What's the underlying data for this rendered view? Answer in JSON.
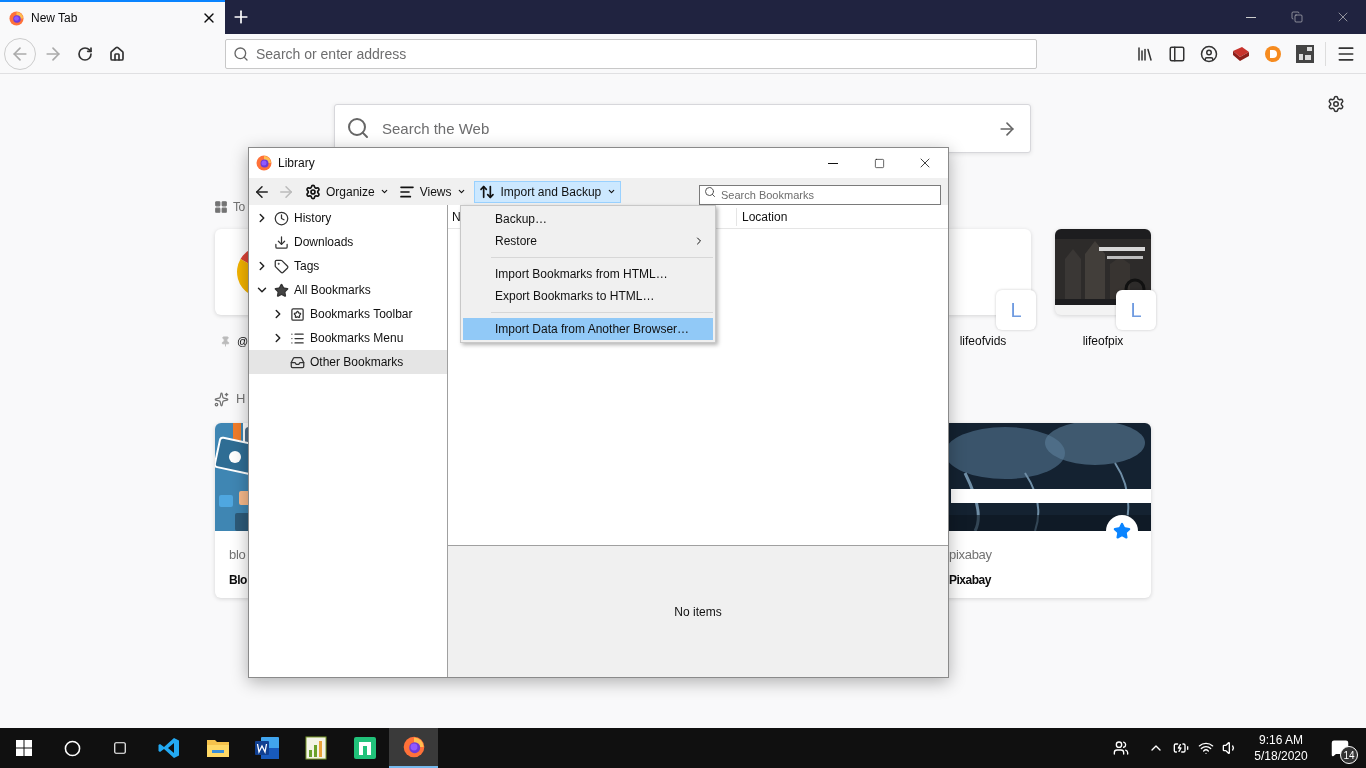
{
  "browser": {
    "tab": {
      "title": "New Tab",
      "selected": true
    },
    "address_bar": {
      "placeholder": "Search or enter address"
    }
  },
  "new_tab": {
    "search": {
      "placeholder": "Search the Web"
    },
    "top_sites": {
      "heading": "To",
      "tiles": [
        {
          "label": "@",
          "kind": "logo",
          "pinned": true
        },
        {
          "label": "lifeofvids",
          "kind": "blank",
          "badge": "L",
          "pinned": false
        },
        {
          "label": "lifeofpix",
          "kind": "picture",
          "badge": "L",
          "pinned": false
        }
      ]
    },
    "highlights": {
      "heading": "H",
      "cards": [
        {
          "source": "blo",
          "title": "Blo",
          "kind": "illustration",
          "bookmarked": false
        },
        {
          "source": "pixabay",
          "title": "Pixabay",
          "bookmarked": true
        }
      ]
    }
  },
  "library": {
    "title": "Library",
    "toolbar": {
      "organize": "Organize",
      "views": "Views",
      "import_backup": {
        "label": "Import and Backup",
        "open": true
      },
      "search": {
        "placeholder": "Search Bookmarks"
      }
    },
    "tree": [
      {
        "label": "History",
        "kind": "history",
        "expanded": false,
        "selected": false
      },
      {
        "label": "Downloads",
        "kind": "downloads",
        "selected": false
      },
      {
        "label": "Tags",
        "kind": "tags",
        "expanded": false,
        "selected": false
      },
      {
        "label": "All Bookmarks",
        "kind": "all",
        "expanded": true,
        "selected": false,
        "children": [
          {
            "label": "Bookmarks Toolbar",
            "kind": "toolbar",
            "expanded": false,
            "selected": false
          },
          {
            "label": "Bookmarks Menu",
            "kind": "menu",
            "expanded": false,
            "selected": false
          },
          {
            "label": "Other Bookmarks",
            "kind": "other",
            "selected": true
          }
        ]
      }
    ],
    "columns": [
      "N",
      "Location"
    ],
    "details": "No items",
    "menu": [
      {
        "kind": "item",
        "label": "Backup…",
        "selected": false
      },
      {
        "kind": "submenu",
        "label": "Restore",
        "selected": false
      },
      {
        "kind": "separator"
      },
      {
        "kind": "item",
        "label": "Import Bookmarks from HTML…",
        "selected": false
      },
      {
        "kind": "item",
        "label": "Export Bookmarks to HTML…",
        "selected": false
      },
      {
        "kind": "separator"
      },
      {
        "kind": "item",
        "label": "Import Data from Another Browser…",
        "selected": true
      }
    ]
  },
  "taskbar": {
    "apps": [
      {
        "kind": "vscode",
        "active": false
      },
      {
        "kind": "files",
        "active": false
      },
      {
        "kind": "word",
        "active": false
      },
      {
        "kind": "chart",
        "active": false
      },
      {
        "kind": "green",
        "active": false
      },
      {
        "kind": "firefox",
        "active": true
      }
    ],
    "clock": {
      "time": "9:16 AM",
      "date": "5/18/2020"
    },
    "notifications": {
      "count": "14"
    }
  }
}
